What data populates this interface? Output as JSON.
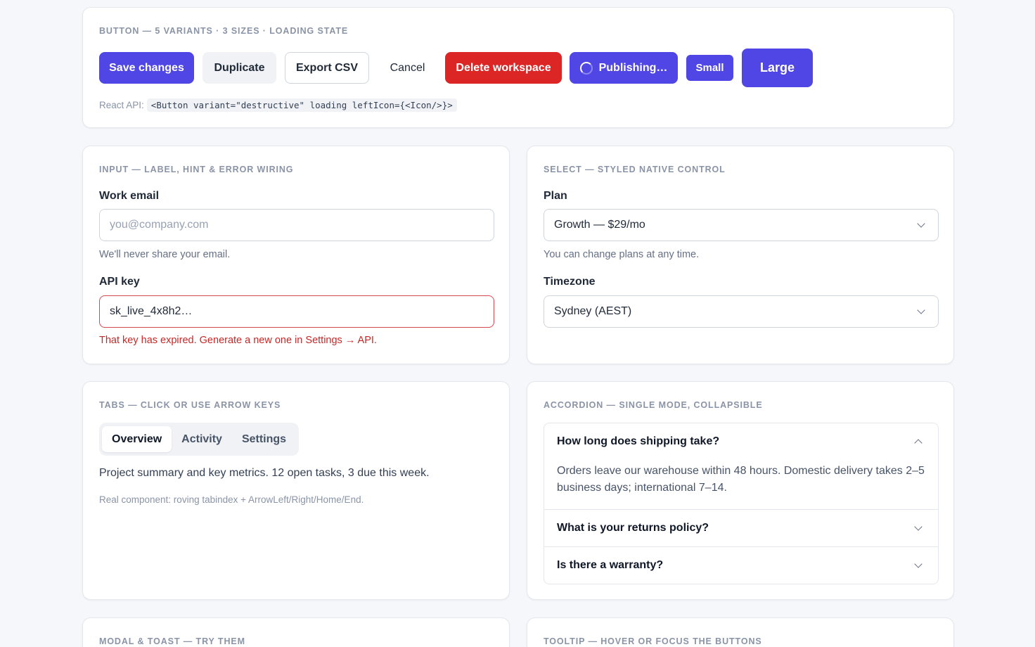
{
  "buttons_card": {
    "title": "BUTTON — 5 VARIANTS · 3 SIZES · LOADING STATE",
    "buttons": {
      "save": "Save changes",
      "duplicate": "Duplicate",
      "export": "Export CSV",
      "cancel": "Cancel",
      "delete": "Delete workspace",
      "publishing": "Publishing…",
      "small": "Small",
      "large": "Large"
    },
    "api_label": "React API:",
    "api_code": "<Button variant=\"destructive\" loading leftIcon={<Icon/>}>"
  },
  "input_card": {
    "title": "INPUT — LABEL, HINT & ERROR WIRING",
    "email_label": "Work email",
    "email_placeholder": "you@company.com",
    "email_value": "",
    "email_hint": "We'll never share your email.",
    "api_label": "API key",
    "api_value": "sk_live_4x8h2…",
    "api_error": "That key has expired. Generate a new one in Settings → API."
  },
  "select_card": {
    "title": "SELECT — STYLED NATIVE CONTROL",
    "plan_label": "Plan",
    "plan_value": "Growth — $29/mo",
    "plan_hint": "You can change plans at any time.",
    "timezone_label": "Timezone",
    "timezone_value": "Sydney (AEST)"
  },
  "tabs_card": {
    "title": "TABS — CLICK OR USE ARROW KEYS",
    "tabs": [
      "Overview",
      "Activity",
      "Settings"
    ],
    "active_tab": "Overview",
    "panel_text": "Project summary and key metrics. 12 open tasks, 3 due this week.",
    "note": "Real component: roving tabindex + ArrowLeft/Right/Home/End."
  },
  "accordion_card": {
    "title": "ACCORDION — SINGLE MODE, COLLAPSIBLE",
    "items": [
      {
        "question": "How long does shipping take?",
        "answer": "Orders leave our warehouse within 48 hours. Domestic delivery takes 2–5 business days; international 7–14.",
        "expanded": true
      },
      {
        "question": "What is your returns policy?",
        "expanded": false
      },
      {
        "question": "Is there a warranty?",
        "expanded": false
      }
    ]
  },
  "modal_card": {
    "title": "MODAL & TOAST — TRY THEM"
  },
  "tooltip_card": {
    "title": "TOOLTIP — HOVER OR FOCUS THE BUTTONS"
  },
  "colors": {
    "primary": "#4f46e5",
    "destructive": "#dc2626",
    "error": "#c62828",
    "background": "#f5f7fa"
  }
}
